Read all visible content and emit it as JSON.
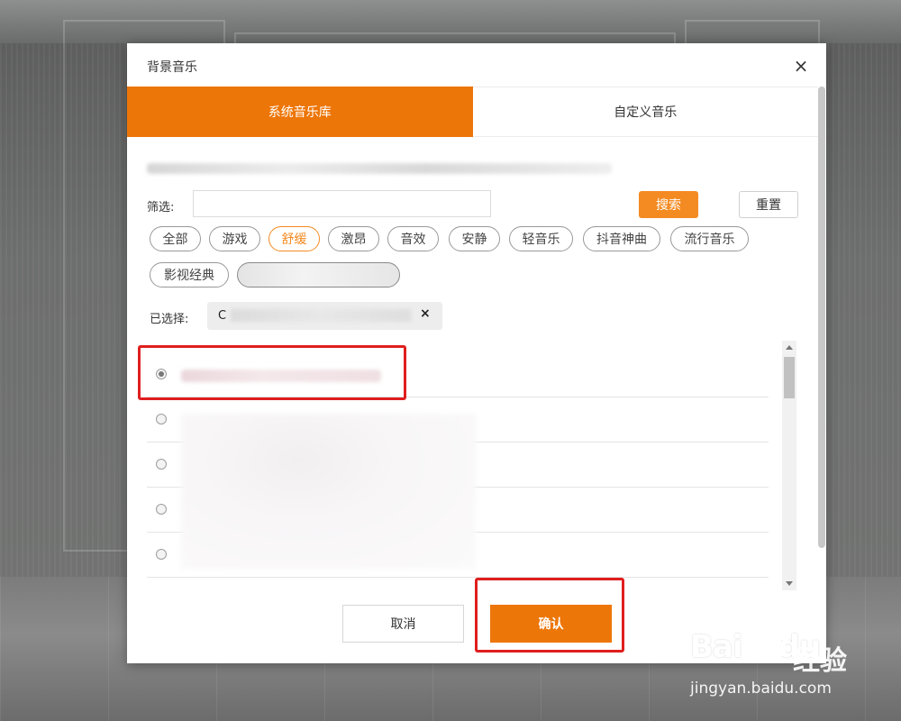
{
  "dialog": {
    "title": "背景音乐",
    "close_symbol": "×"
  },
  "tabs": [
    {
      "label": "系统音乐库",
      "active": true
    },
    {
      "label": "自定义音乐",
      "active": false
    }
  ],
  "filter": {
    "label": "筛选:",
    "search_value": "",
    "search_button": "搜索",
    "reset_button": "重置"
  },
  "tags": [
    {
      "label": "全部",
      "active": false
    },
    {
      "label": "游戏",
      "active": false
    },
    {
      "label": "舒缓",
      "active": true
    },
    {
      "label": "激昂",
      "active": false
    },
    {
      "label": "音效",
      "active": false
    },
    {
      "label": "安静",
      "active": false
    },
    {
      "label": "轻音乐",
      "active": false
    },
    {
      "label": "抖音神曲",
      "active": false
    },
    {
      "label": "流行音乐",
      "active": false
    },
    {
      "label": "影视经典",
      "active": false
    },
    {
      "label": "",
      "active": false
    }
  ],
  "selected": {
    "label": "已选择:",
    "chip_text": "C",
    "remove_symbol": "×"
  },
  "music_list": [
    {
      "checked": true,
      "first_char": ""
    },
    {
      "checked": false,
      "first_char": ""
    },
    {
      "checked": false,
      "first_char": "("
    },
    {
      "checked": false,
      "first_char": "("
    },
    {
      "checked": false,
      "first_char": ""
    }
  ],
  "footer": {
    "cancel_label": "取消",
    "confirm_label": "确认"
  },
  "watermark": {
    "logo_text": "Bai",
    "logo_text_2": "du",
    "cn_text": "经验",
    "url": "jingyan.baidu.com"
  },
  "colors": {
    "accent": "#ed7608",
    "search_button": "#f48b22",
    "highlight": "#e01e1e"
  }
}
